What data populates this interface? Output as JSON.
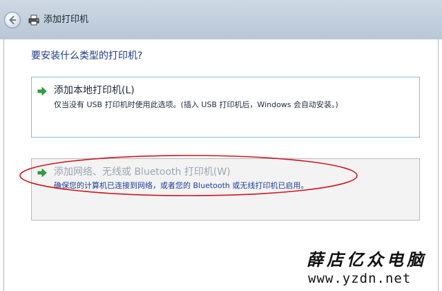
{
  "window": {
    "title": "添加打印机",
    "accent_color": "#7fb9e6"
  },
  "main": {
    "question": "要安装什么类型的打印机?",
    "options": [
      {
        "title": "添加本地打印机(L)",
        "description": "仅当没有 USB 打印机时使用此选项。(插入 USB 打印机后，Windows 会自动安装。)",
        "icon": "green-arrow-icon"
      },
      {
        "title": "添加网络、无线或 Bluetooth 打印机(W)",
        "description": "确保您的计算机已连接到网络，或者您的 Bluetooth 或无线打印机已启用。",
        "icon": "green-arrow-icon"
      }
    ]
  },
  "watermark": {
    "name": "薛店亿众电脑",
    "url": "www.yzdn.net"
  },
  "annotation_color": "#d0141c"
}
